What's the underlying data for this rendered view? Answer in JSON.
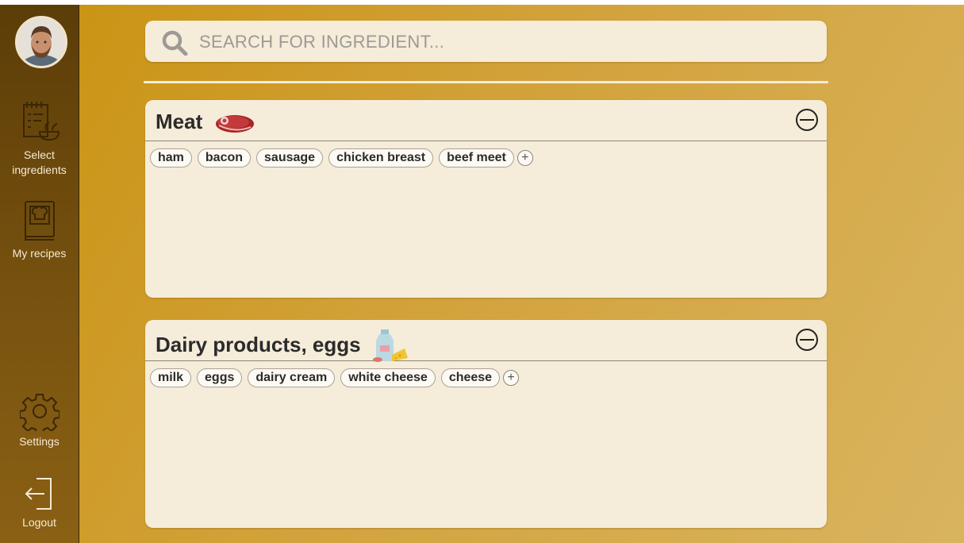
{
  "sidebar": {
    "items": [
      {
        "label": "Select ingredients",
        "icon": "recipe-list-icon"
      },
      {
        "label": "My recipes",
        "icon": "recipe-book-icon"
      },
      {
        "label": "Settings",
        "icon": "gear-icon"
      },
      {
        "label": "Logout",
        "icon": "logout-icon"
      }
    ]
  },
  "search": {
    "placeholder": "SEARCH FOR INGREDIENT...",
    "icon": "search-icon"
  },
  "categories": [
    {
      "title": "Meat",
      "icon": "steak-icon",
      "items": [
        "ham",
        "bacon",
        "sausage",
        "chicken breast",
        "beef meet"
      ],
      "add_label": "+"
    },
    {
      "title": "Dairy products, eggs",
      "icon": "milk-cheese-icon",
      "items": [
        "milk",
        "eggs",
        "dairy cream",
        "white cheese",
        "cheese"
      ],
      "add_label": "+"
    }
  ],
  "colors": {
    "sidebar": "#6b470c",
    "background": "#cf9e30",
    "panel": "#f5ecd9"
  }
}
